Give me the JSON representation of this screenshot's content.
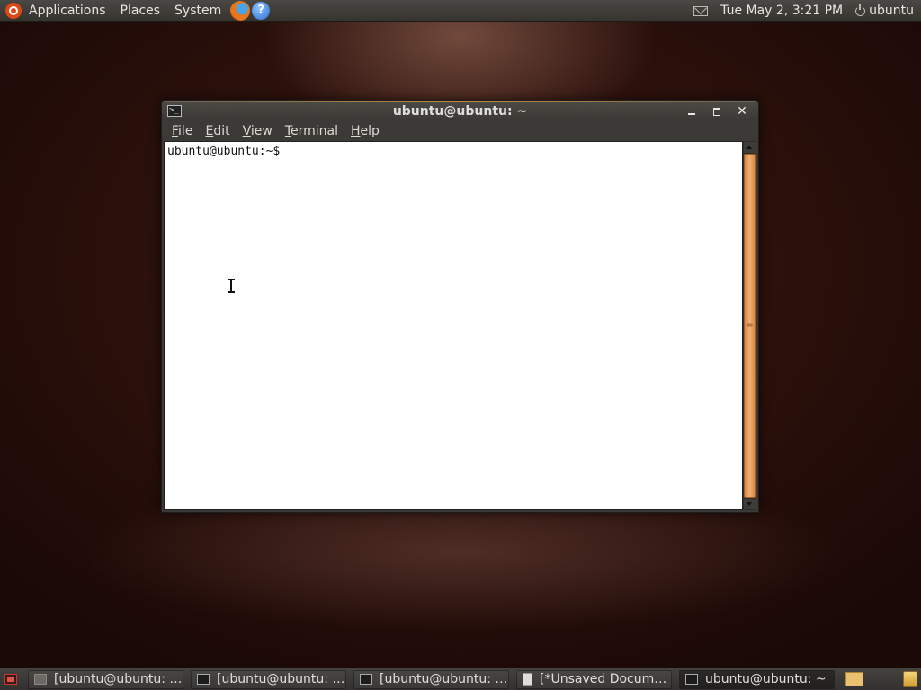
{
  "top_panel": {
    "menus": [
      "Applications",
      "Places",
      "System"
    ],
    "launchers": [
      "firefox-icon",
      "help-icon"
    ],
    "help_glyph": "?",
    "clock": "Tue May  2,  3:21 PM",
    "user": "ubuntu"
  },
  "window": {
    "title": "ubuntu@ubuntu: ~",
    "menu": {
      "file": {
        "u": "F",
        "rest": "ile"
      },
      "edit": {
        "u": "E",
        "rest": "dit"
      },
      "view": {
        "u": "V",
        "rest": "iew"
      },
      "terminal": {
        "u": "T",
        "rest": "erminal"
      },
      "help": {
        "u": "H",
        "rest": "elp"
      }
    },
    "close_glyph": "✕",
    "prompt": "ubuntu@ubuntu:~$"
  },
  "taskbar": {
    "tasks": [
      {
        "label": "[ubuntu@ubuntu: ~]",
        "icon": "terminal-minimized-icon",
        "state": "minimized"
      },
      {
        "label": "[ubuntu@ubuntu: ~]",
        "icon": "terminal-icon",
        "state": "minimized"
      },
      {
        "label": "[ubuntu@ubuntu: ~]",
        "icon": "terminal-icon",
        "state": "minimized"
      },
      {
        "label": "[*Unsaved Docume...",
        "icon": "text-editor-icon",
        "state": "minimized"
      },
      {
        "label": "ubuntu@ubuntu: ~",
        "icon": "terminal-icon",
        "state": "active"
      }
    ]
  },
  "colors": {
    "accent_orange": "#f0b070",
    "panel_bg": "#3c3a36",
    "desktop_bg": "#2a100b"
  }
}
